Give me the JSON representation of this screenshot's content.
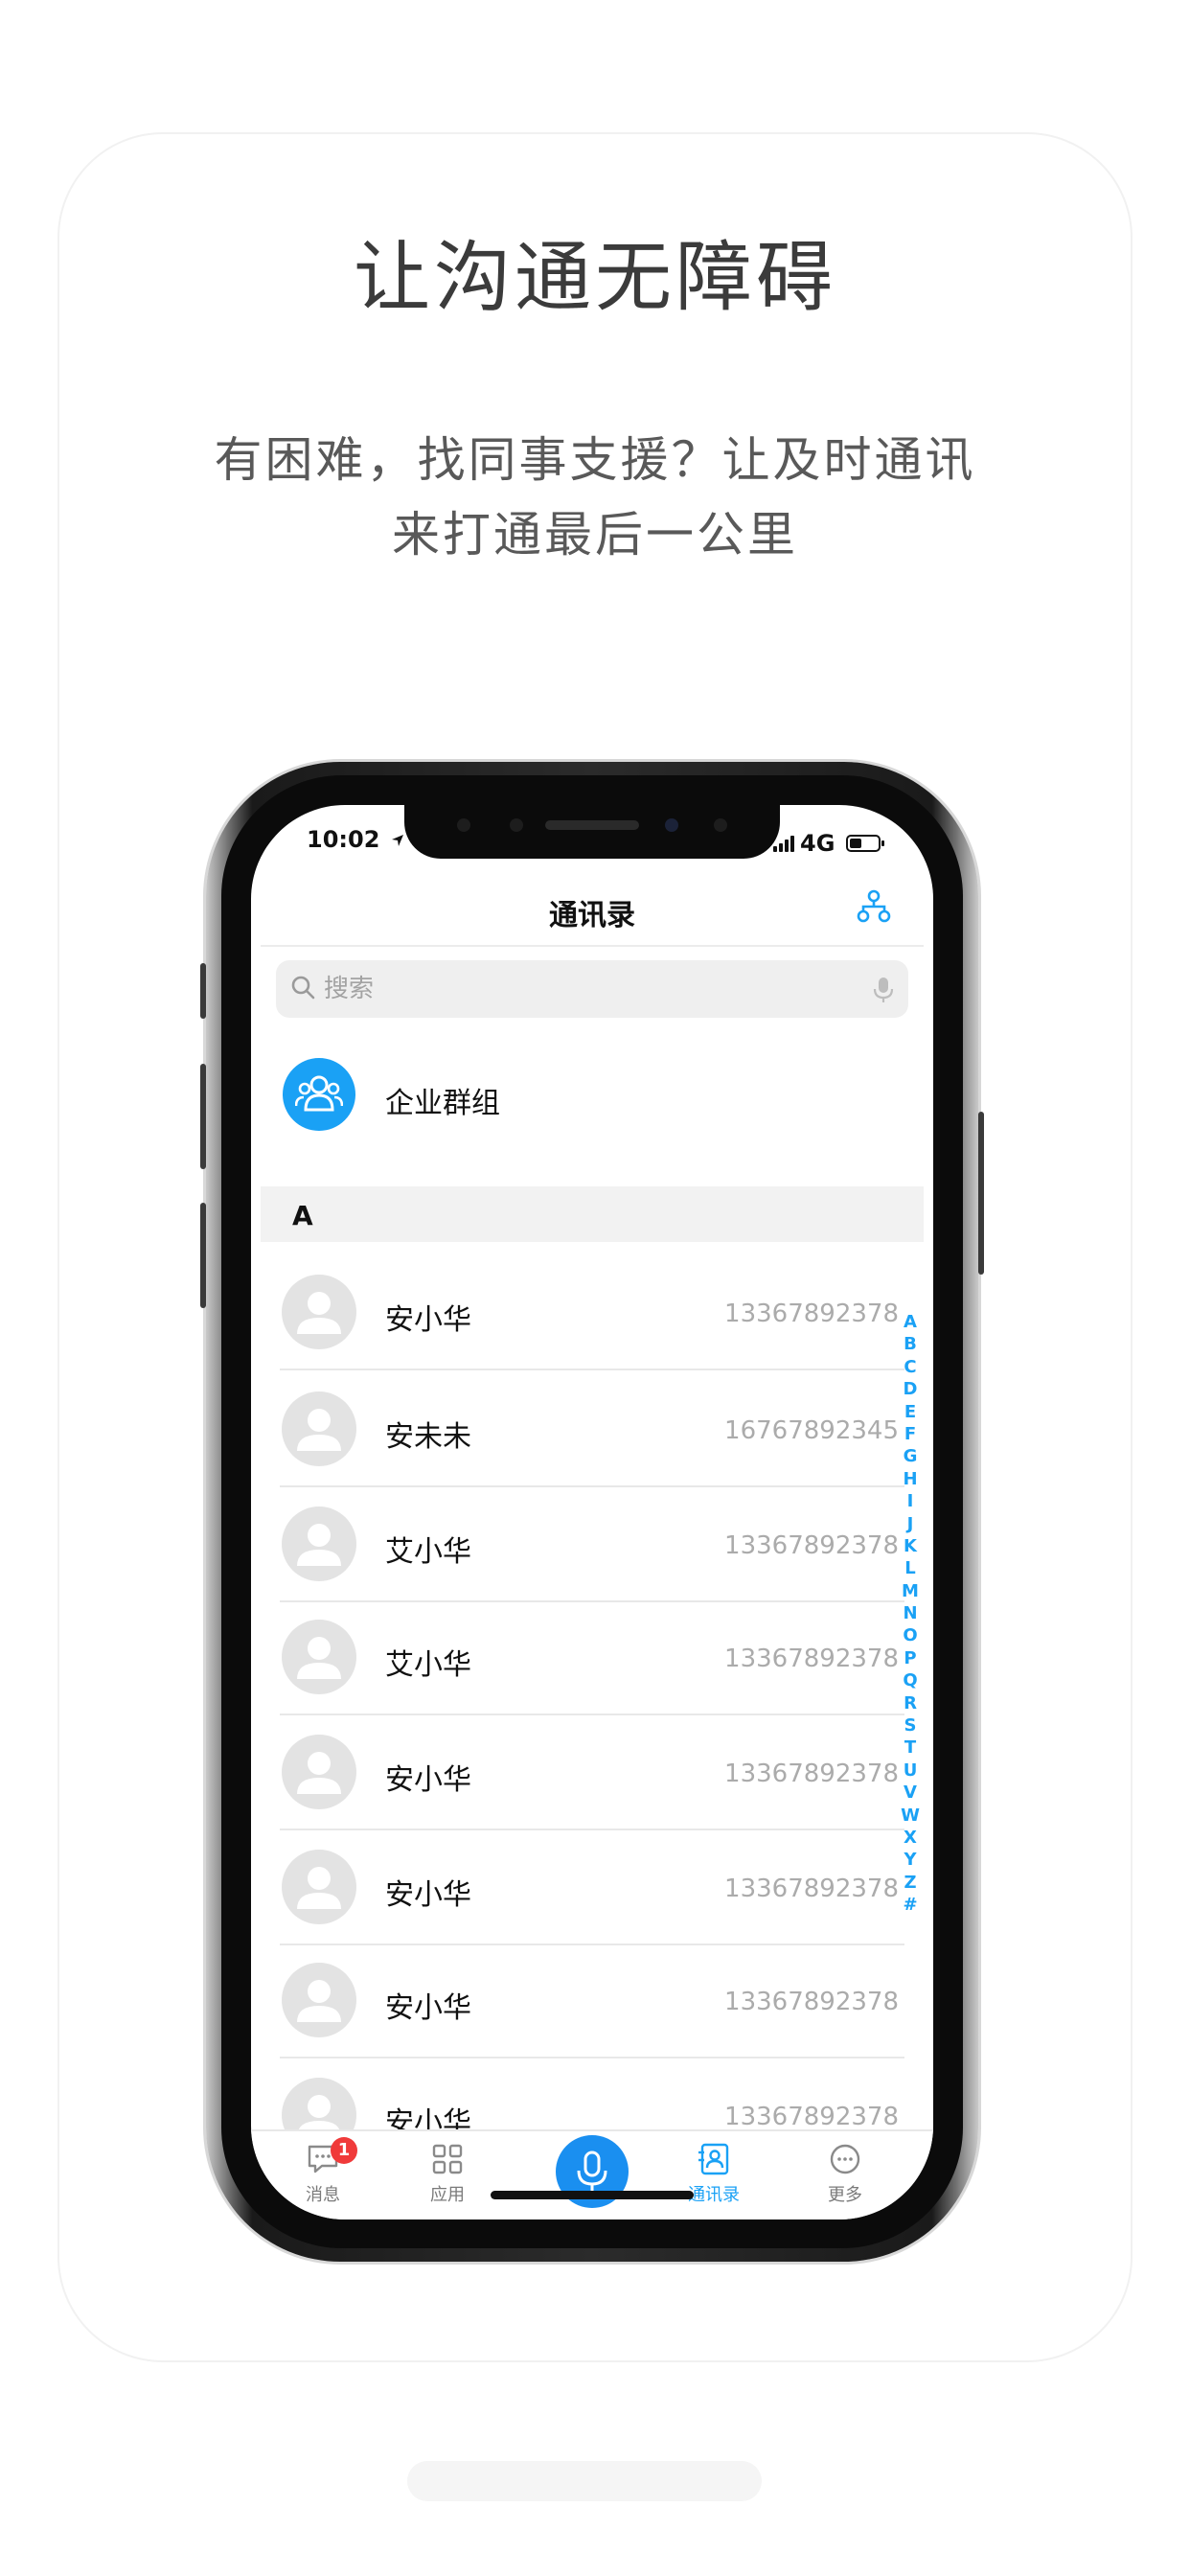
{
  "headline": "让沟通无障碍",
  "subtitle_line1": "有困难，找同事支援？让及时通讯",
  "subtitle_line2": "来打通最后一公里",
  "status_bar": {
    "time": "10:02",
    "network": "4G"
  },
  "nav": {
    "title": "通讯录",
    "org_icon": "org-chart-icon"
  },
  "search": {
    "placeholder": "搜索"
  },
  "group_entry": {
    "label": "企业群组",
    "icon": "group-users-icon"
  },
  "section_letter": "A",
  "contacts": [
    {
      "name": "安小华",
      "phone": "13367892378"
    },
    {
      "name": "安未未",
      "phone": "16767892345"
    },
    {
      "name": "艾小华",
      "phone": "13367892378"
    },
    {
      "name": "艾小华",
      "phone": "13367892378"
    },
    {
      "name": "安小华",
      "phone": "13367892378"
    },
    {
      "name": "安小华",
      "phone": "13367892378"
    },
    {
      "name": "安小华",
      "phone": "13367892378"
    },
    {
      "name": "安小华",
      "phone": "13367892378"
    }
  ],
  "index_letters": [
    "A",
    "B",
    "C",
    "D",
    "E",
    "F",
    "G",
    "H",
    "I",
    "J",
    "K",
    "L",
    "M",
    "N",
    "O",
    "P",
    "Q",
    "R",
    "S",
    "T",
    "U",
    "V",
    "W",
    "X",
    "Y",
    "Z",
    "#"
  ],
  "tabs": [
    {
      "label": "消息",
      "icon": "message-icon",
      "badge": "1"
    },
    {
      "label": "应用",
      "icon": "apps-grid-icon"
    },
    {
      "label": "通讯录",
      "icon": "contacts-icon",
      "active": true
    },
    {
      "label": "更多",
      "icon": "more-icon"
    }
  ],
  "colors": {
    "accent": "#1aa1f5",
    "badge": "#f03a3a",
    "mic": "#1a8ff0"
  }
}
